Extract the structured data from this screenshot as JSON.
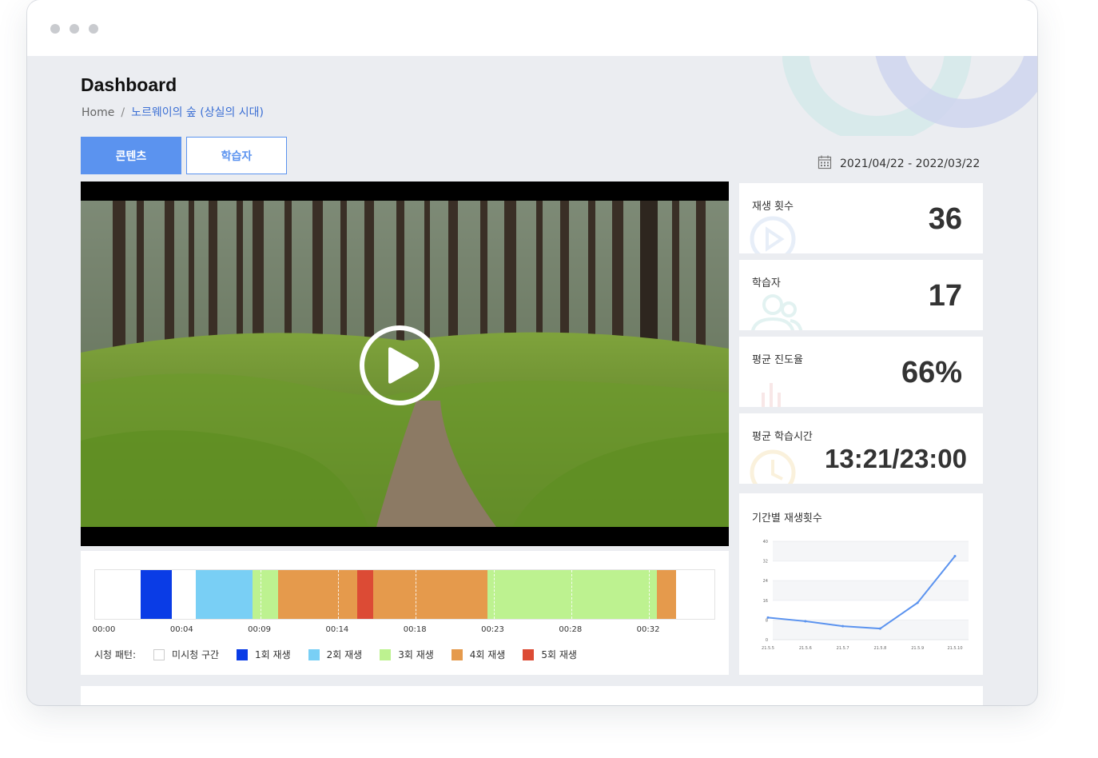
{
  "window": {
    "controls": [
      "close",
      "minimize",
      "maximize"
    ]
  },
  "header": {
    "title": "Dashboard",
    "breadcrumb": {
      "home": "Home",
      "separator": "/",
      "current": "노르웨이의 숲 (상실의 시대)"
    }
  },
  "tabs": [
    {
      "label": "콘텐츠",
      "active": true
    },
    {
      "label": "학습자",
      "active": false
    }
  ],
  "date_range": {
    "icon": "calendar-icon",
    "text": "2021/04/22 -  2022/03/22"
  },
  "video": {
    "icon": "play-icon",
    "state": "paused"
  },
  "playback_heatmap": {
    "ticks": [
      "00:00",
      "00:04",
      "00:09",
      "00:14",
      "00:18",
      "00:23",
      "00:28",
      "00:32"
    ],
    "legend_title": "시청 패턴:",
    "legend": [
      {
        "label": "미시청 구간",
        "color": "#ffffff"
      },
      {
        "label": "1회 재생",
        "color": "#0a3ce6"
      },
      {
        "label": "2회 재생",
        "color": "#79cff5"
      },
      {
        "label": "3회 재생",
        "color": "#bdf290"
      },
      {
        "label": "4회 재생",
        "color": "#e59a4c"
      },
      {
        "label": "5회 재생",
        "color": "#dc4b35"
      }
    ],
    "segments": [
      {
        "level": 0,
        "start": 0.0,
        "end": 0.073
      },
      {
        "level": 1,
        "start": 0.073,
        "end": 0.124
      },
      {
        "level": 0,
        "start": 0.124,
        "end": 0.162
      },
      {
        "level": 2,
        "start": 0.162,
        "end": 0.254
      },
      {
        "level": 3,
        "start": 0.254,
        "end": 0.296
      },
      {
        "level": 4,
        "start": 0.296,
        "end": 0.423
      },
      {
        "level": 5,
        "start": 0.423,
        "end": 0.449
      },
      {
        "level": 4,
        "start": 0.449,
        "end": 0.633
      },
      {
        "level": 3,
        "start": 0.633,
        "end": 0.907
      },
      {
        "level": 4,
        "start": 0.907,
        "end": 0.938
      },
      {
        "level": 0,
        "start": 0.938,
        "end": 1.0
      }
    ]
  },
  "stats": [
    {
      "label": "재생 횟수",
      "value": "36",
      "icon": "play-circle-icon"
    },
    {
      "label": "학습자",
      "value": "17",
      "icon": "users-icon"
    },
    {
      "label": "평균 진도율",
      "value": "66%",
      "icon": "bar-chart-icon"
    },
    {
      "label": "평균 학습시간",
      "value": "13:21/23:00",
      "icon": "clock-icon"
    }
  ],
  "colors": {
    "accent": "#5b93ef",
    "line": "#5b93ef",
    "background": "#ebedf1"
  },
  "chart_data": {
    "type": "line",
    "title": "기간별 재생횟수",
    "categories": [
      "21.5.5",
      "21.5.6",
      "21.5.7",
      "21.5.8",
      "21.5.9",
      "21.5.10"
    ],
    "y_ticks": [
      "40",
      "32",
      "24",
      "16",
      "8",
      "0"
    ],
    "ylim": [
      0,
      40
    ],
    "series": [
      {
        "values": [
          9,
          7.5,
          5.5,
          4.5,
          15,
          34
        ]
      }
    ],
    "grid": true,
    "legend": "none"
  }
}
